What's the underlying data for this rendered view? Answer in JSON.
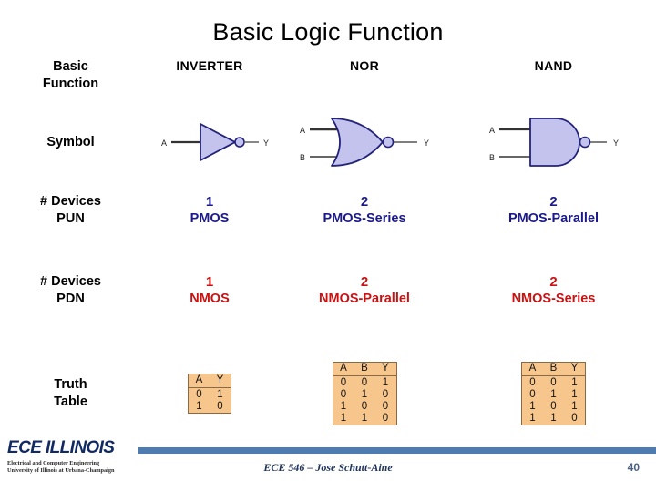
{
  "slide": {
    "title": "Basic Logic Function",
    "page_number": "40",
    "footer_text": "ECE 546 – Jose Schutt-Aine"
  },
  "logo": {
    "main": "ECE ILLINOIS",
    "sub1": "Electrical and Computer Engineering",
    "sub2": "University of Illinois at Urbana-Champaign"
  },
  "colors": {
    "gate_fill": "#c3c3ee",
    "gate_stroke": "#23237a",
    "truth_bg": "#f7c68c",
    "truth_border": "#8a6a44",
    "pun_text": "#1a1a8c",
    "pdn_text": "#cc1111",
    "footer_bar": "#4f7cb0"
  },
  "table": {
    "row_labels": {
      "header": "Basic\nFunction",
      "header_line1": "Basic",
      "header_line2": "Function",
      "symbol": "Symbol",
      "pun_line1": "# Devices",
      "pun_line2": "PUN",
      "pdn_line1": "# Devices",
      "pdn_line2": "PDN",
      "truth_line1": "Truth",
      "truth_line2": "Table"
    },
    "columns": [
      {
        "name": "INVERTER"
      },
      {
        "name": "NOR"
      },
      {
        "name": "NAND"
      }
    ],
    "symbols": [
      {
        "gate": "inverter-symbol",
        "inputs": [
          "A"
        ],
        "output": "Y"
      },
      {
        "gate": "nor-symbol",
        "inputs": [
          "A",
          "B"
        ],
        "output": "Y"
      },
      {
        "gate": "nand-symbol",
        "inputs": [
          "A",
          "B"
        ],
        "output": "Y"
      }
    ],
    "pun": [
      {
        "count": "1",
        "text": "PMOS"
      },
      {
        "count": "2",
        "text": "PMOS-Series"
      },
      {
        "count": "2",
        "text": "PMOS-Parallel"
      }
    ],
    "pdn": [
      {
        "count": "1",
        "text": "NMOS"
      },
      {
        "count": "2",
        "text": "NMOS-Parallel"
      },
      {
        "count": "2",
        "text": "NMOS-Series"
      }
    ],
    "truth_tables": [
      {
        "gate": "INVERTER",
        "headers": [
          "A",
          "Y"
        ],
        "rows": [
          [
            "0",
            "1"
          ],
          [
            "1",
            "0"
          ]
        ]
      },
      {
        "gate": "NOR",
        "headers": [
          "A",
          "B",
          "Y"
        ],
        "rows": [
          [
            "0",
            "0",
            "1"
          ],
          [
            "0",
            "1",
            "0"
          ],
          [
            "1",
            "0",
            "0"
          ],
          [
            "1",
            "1",
            "0"
          ]
        ]
      },
      {
        "gate": "NAND",
        "headers": [
          "A",
          "B",
          "Y"
        ],
        "rows": [
          [
            "0",
            "0",
            "1"
          ],
          [
            "0",
            "1",
            "1"
          ],
          [
            "1",
            "0",
            "1"
          ],
          [
            "1",
            "1",
            "0"
          ]
        ]
      }
    ]
  }
}
